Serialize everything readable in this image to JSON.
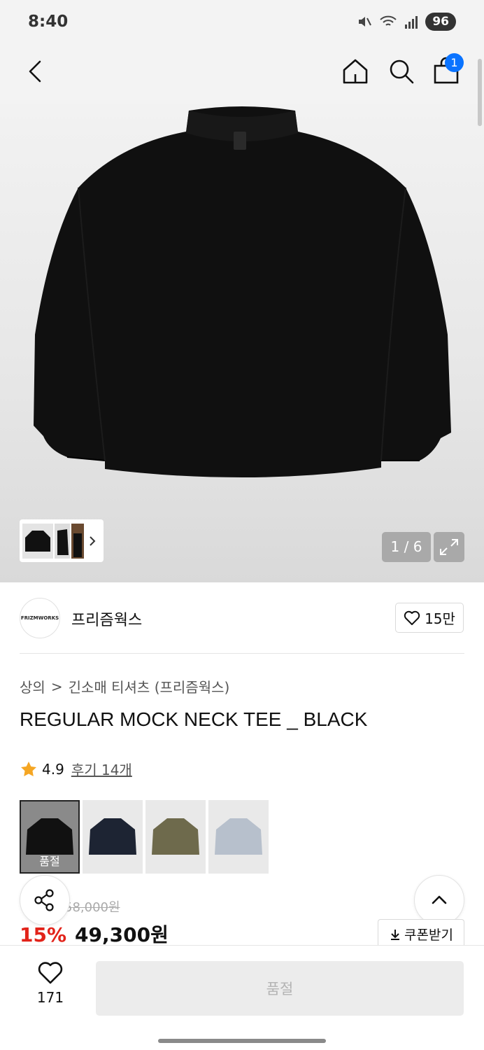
{
  "status_bar": {
    "time": "8:40",
    "battery": "96"
  },
  "header": {
    "cart_count": "1"
  },
  "gallery": {
    "page_indicator": "1 / 6"
  },
  "brand": {
    "logo_text": "FRIZMWORKS",
    "name": "프리즘웍스",
    "likes": "15만"
  },
  "breadcrumb": {
    "category": "상의",
    "separator": ">",
    "subcategory": "긴소매 티셔츠 (프리즘웍스)"
  },
  "product": {
    "title": "REGULAR MOCK NECK TEE _ BLACK",
    "rating": "4.9",
    "review_link": "후기 14개",
    "original_price": "58,000원",
    "discount": "15%",
    "price": "49,300원",
    "coupon_label": "쿠폰받기"
  },
  "swatches": [
    {
      "color": "#111111",
      "label": "품절",
      "selected": true
    },
    {
      "color": "#1d2433",
      "label": "",
      "selected": false
    },
    {
      "color": "#6e6a4c",
      "label": "",
      "selected": false
    },
    {
      "color": "#b7c0cc",
      "label": "",
      "selected": false
    }
  ],
  "bottom_bar": {
    "wish_count": "171",
    "buy_label": "품절"
  },
  "colors": {
    "accent_blue": "#0a73ff",
    "discount_red": "#e2231a"
  }
}
